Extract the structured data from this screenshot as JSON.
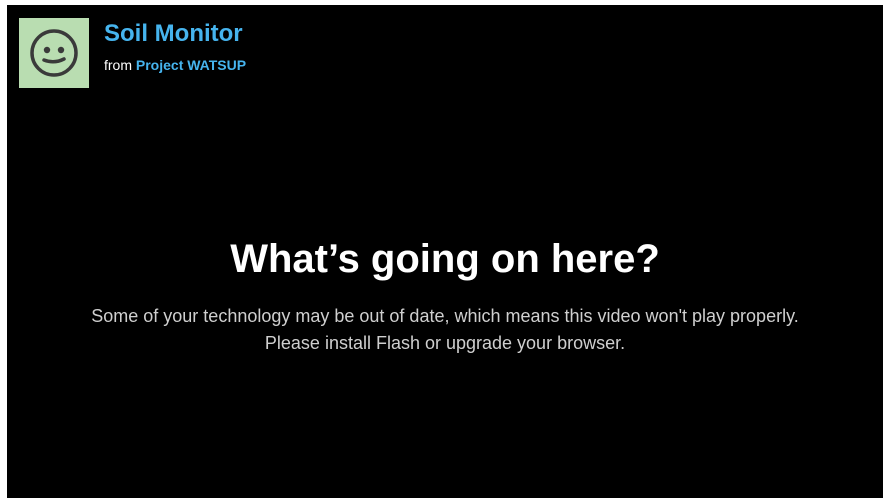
{
  "theme": {
    "accent": "#46b4ee",
    "background": "#000000",
    "thumbnail_bg": "#b9ddb1"
  },
  "header": {
    "thumbnail_icon": "smiley-face-icon",
    "title": "Soil Monitor",
    "from_label": "from",
    "owner": "Project WATSUP"
  },
  "message": {
    "heading": "What’s going on here?",
    "body": "Some of your technology may be out of date, which means this video won't play properly. Please install Flash or upgrade your browser."
  }
}
